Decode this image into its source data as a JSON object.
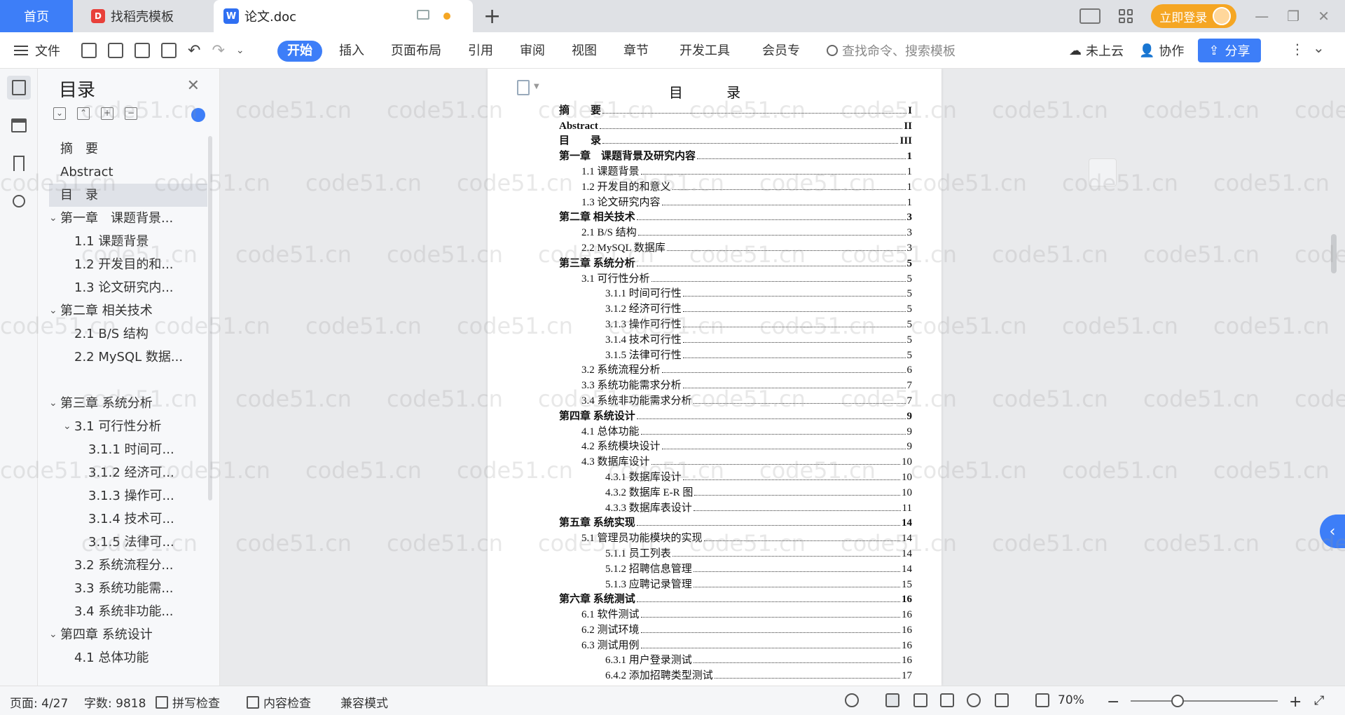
{
  "tabs": {
    "home": "首页",
    "find": "找稻壳模板",
    "doc": "论文.doc",
    "login": "立即登录"
  },
  "toolbar": {
    "file": "文件",
    "ribbon": [
      "开始",
      "插入",
      "页面布局",
      "引用",
      "审阅",
      "视图",
      "章节",
      "开发工具",
      "会员专"
    ],
    "search_placeholder": "查找命令、搜索模板",
    "cloud": "未上云",
    "collab": "协作",
    "share": "分享"
  },
  "toc_panel": {
    "title": "目录",
    "items": [
      {
        "label": "摘　要",
        "level": 1
      },
      {
        "label": "Abstract",
        "level": 1
      },
      {
        "label": "目　录",
        "level": 1,
        "selected": true
      },
      {
        "label": "第一章　课题背景...",
        "level": 1,
        "expand": true
      },
      {
        "label": "1.1 课题背景",
        "level": 2
      },
      {
        "label": "1.2 开发目的和...",
        "level": 2
      },
      {
        "label": "1.3 论文研究内...",
        "level": 2
      },
      {
        "label": "第二章 相关技术",
        "level": 1,
        "expand": true
      },
      {
        "label": "2.1 B/S 结构",
        "level": 2
      },
      {
        "label": "2.2 MySQL 数据...",
        "level": 2
      },
      {
        "label": "第三章 系统分析",
        "level": 1,
        "expand": true
      },
      {
        "label": "3.1 可行性分析",
        "level": 2,
        "expand": true
      },
      {
        "label": "3.1.1 时间可...",
        "level": 3
      },
      {
        "label": "3.1.2 经济可...",
        "level": 3
      },
      {
        "label": "3.1.3 操作可...",
        "level": 3
      },
      {
        "label": "3.1.4 技术可...",
        "level": 3
      },
      {
        "label": "3.1.5 法律可...",
        "level": 3
      },
      {
        "label": "3.2 系统流程分...",
        "level": 2
      },
      {
        "label": "3.3 系统功能需...",
        "level": 2
      },
      {
        "label": "3.4 系统非功能...",
        "level": 2
      },
      {
        "label": "第四章 系统设计",
        "level": 1,
        "expand": true
      },
      {
        "label": "4.1 总体功能",
        "level": 2
      }
    ]
  },
  "document": {
    "title": "目 录",
    "entries": [
      {
        "label": "摘　　要",
        "page": "I",
        "bold": true,
        "level": 1
      },
      {
        "label": "Abstract",
        "page": "II",
        "bold": true,
        "level": 1
      },
      {
        "label": "目　　录",
        "page": "III",
        "bold": true,
        "level": 1
      },
      {
        "label": "第一章　课题背景及研究内容",
        "page": "1",
        "bold": true,
        "level": 1
      },
      {
        "label": "1.1  课题背景",
        "page": "1",
        "level": 2
      },
      {
        "label": "1.2  开发目的和意义",
        "page": "1",
        "level": 2
      },
      {
        "label": "1.3  论文研究内容",
        "page": "1",
        "level": 2
      },
      {
        "label": "第二章  相关技术",
        "page": "3",
        "bold": true,
        "level": 1
      },
      {
        "label": "2.1 B/S 结构",
        "page": "3",
        "level": 2
      },
      {
        "label": "2.2  MySQL 数据库",
        "page": "3",
        "level": 2
      },
      {
        "label": "第三章  系统分析",
        "page": "5",
        "bold": true,
        "level": 1
      },
      {
        "label": "3.1  可行性分析",
        "page": "5",
        "level": 2
      },
      {
        "label": "3.1.1  时间可行性",
        "page": "5",
        "level": 3
      },
      {
        "label": "3.1.2  经济可行性",
        "page": "5",
        "level": 3
      },
      {
        "label": "3.1.3  操作可行性",
        "page": "5",
        "level": 3
      },
      {
        "label": "3.1.4  技术可行性",
        "page": "5",
        "level": 3
      },
      {
        "label": "3.1.5  法律可行性",
        "page": "5",
        "level": 3
      },
      {
        "label": "3.2 系统流程分析",
        "page": "6",
        "level": 2
      },
      {
        "label": "3.3 系统功能需求分析",
        "page": "7",
        "level": 2
      },
      {
        "label": "3.4  系统非功能需求分析",
        "page": "7",
        "level": 2
      },
      {
        "label": "第四章  系统设计",
        "page": "9",
        "bold": true,
        "level": 1
      },
      {
        "label": "4.1  总体功能",
        "page": "9",
        "level": 2
      },
      {
        "label": "4.2  系统模块设计",
        "page": "9",
        "level": 2
      },
      {
        "label": "4.3  数据库设计",
        "page": "10",
        "level": 2
      },
      {
        "label": "4.3.1  数据库设计",
        "page": "10",
        "level": 3
      },
      {
        "label": "4.3.2  数据库 E-R 图",
        "page": "10",
        "level": 3
      },
      {
        "label": "4.3.3  数据库表设计",
        "page": "11",
        "level": 3
      },
      {
        "label": "第五章  系统实现",
        "page": "14",
        "bold": true,
        "level": 1
      },
      {
        "label": "5.1  管理员功能模块的实现",
        "page": "14",
        "level": 2
      },
      {
        "label": "5.1.1  员工列表",
        "page": "14",
        "level": 3
      },
      {
        "label": "5.1.2  招聘信息管理",
        "page": "14",
        "level": 3
      },
      {
        "label": "5.1.3  应聘记录管理",
        "page": "15",
        "level": 3
      },
      {
        "label": "第六章  系统测试",
        "page": "16",
        "bold": true,
        "level": 1
      },
      {
        "label": "6.1 软件测试",
        "page": "16",
        "level": 2
      },
      {
        "label": "6.2 测试环境",
        "page": "16",
        "level": 2
      },
      {
        "label": "6.3  测试用例",
        "page": "16",
        "level": 2
      },
      {
        "label": "6.3.1  用户登录测试",
        "page": "16",
        "level": 3
      },
      {
        "label": "6.4.2  添加招聘类型测试",
        "page": "17",
        "level": 3
      }
    ]
  },
  "watermark": "code51.cn",
  "statusbar": {
    "page": "页面: 4/27",
    "words": "字数: 9818",
    "spell": "拼写检查",
    "content_check": "内容检查",
    "compat": "兼容模式",
    "zoom": "70%"
  },
  "colors": {
    "accent": "#3d7ef8",
    "login": "#f5a623"
  }
}
